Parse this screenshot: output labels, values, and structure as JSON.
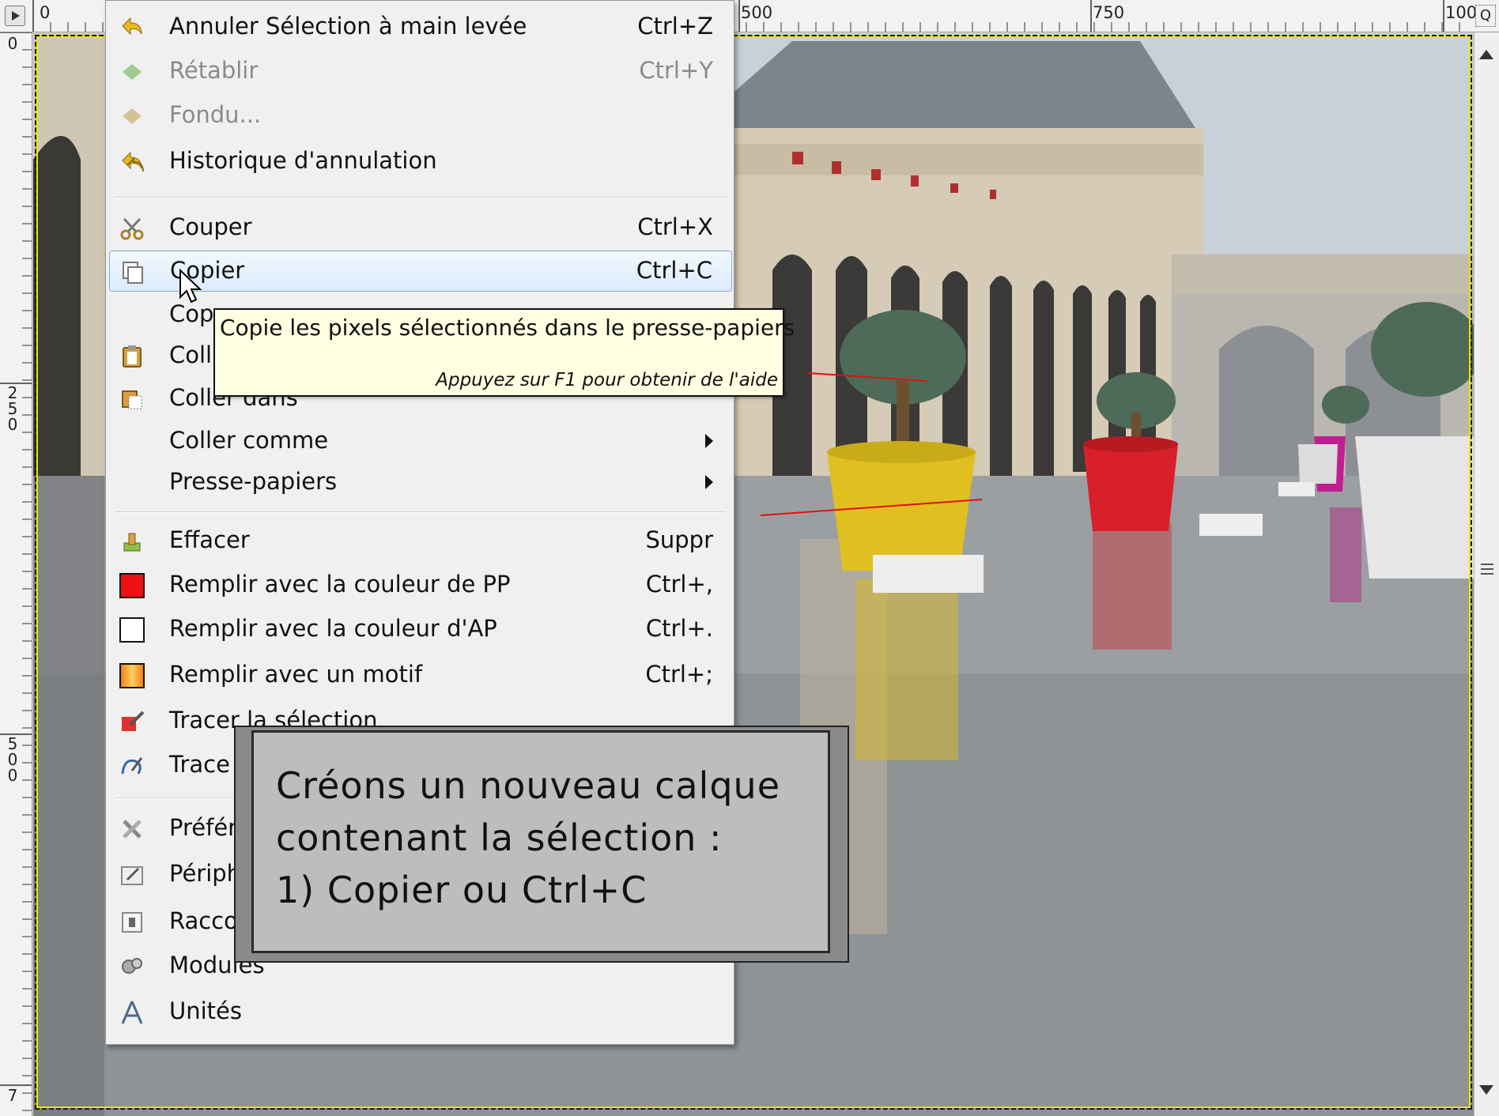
{
  "rulers": {
    "top_ticks": [
      "0",
      "500",
      "750",
      "100"
    ],
    "left_ticks": [
      "0",
      "2\n5\n0",
      "5\n0\n0",
      "7"
    ]
  },
  "zoom_button_label": "Q",
  "edit_menu": {
    "items": [
      {
        "label": "Annuler Sélection à main levée",
        "shortcut": "Ctrl+Z",
        "icon": "undo-icon",
        "enabled": true
      },
      {
        "label": "Rétablir",
        "shortcut": "Ctrl+Y",
        "icon": "redo-icon",
        "enabled": false
      },
      {
        "label": "Fondu...",
        "shortcut": "",
        "icon": "fade-icon",
        "enabled": false
      },
      {
        "label": "Historique d'annulation",
        "shortcut": "",
        "icon": "undo-history-icon",
        "enabled": true
      },
      {
        "label": "Couper",
        "shortcut": "Ctrl+X",
        "icon": "scissors-icon",
        "enabled": true
      },
      {
        "label": "Copier",
        "shortcut": "Ctrl+C",
        "icon": "copy-icon",
        "enabled": true,
        "highlighted": true
      },
      {
        "label": "Cop",
        "shortcut": "",
        "icon": "",
        "enabled": true
      },
      {
        "label": "Coll",
        "shortcut": "",
        "icon": "paste-icon",
        "enabled": true
      },
      {
        "label": "Coller dans",
        "shortcut": "",
        "icon": "paste-into-icon",
        "enabled": true
      },
      {
        "label": "Coller comme",
        "shortcut": "",
        "icon": "",
        "enabled": true,
        "submenu": true
      },
      {
        "label": "Presse-papiers",
        "shortcut": "",
        "icon": "",
        "enabled": true,
        "submenu": true
      },
      {
        "label": "Effacer",
        "shortcut": "Suppr",
        "icon": "clear-icon",
        "enabled": true
      },
      {
        "label": "Remplir avec la couleur de PP",
        "shortcut": "Ctrl+,",
        "icon": "fill-fg-icon",
        "enabled": true
      },
      {
        "label": "Remplir avec la couleur d'AP",
        "shortcut": "Ctrl+.",
        "icon": "fill-bg-icon",
        "enabled": true
      },
      {
        "label": "Remplir avec un motif",
        "shortcut": "Ctrl+;",
        "icon": "fill-pattern-icon",
        "enabled": true
      },
      {
        "label": "Tracer la sélection",
        "shortcut": "",
        "icon": "stroke-selection-icon",
        "enabled": true
      },
      {
        "label": "Trace",
        "shortcut": "",
        "icon": "stroke-path-icon",
        "enabled": true
      },
      {
        "label": "Préfér",
        "shortcut": "",
        "icon": "preferences-icon",
        "enabled": true
      },
      {
        "label": "Périph",
        "shortcut": "",
        "icon": "devices-icon",
        "enabled": true
      },
      {
        "label": "Racco",
        "shortcut": "",
        "icon": "shortcuts-icon",
        "enabled": true
      },
      {
        "label": "Modules",
        "shortcut": "",
        "icon": "modules-icon",
        "enabled": true
      },
      {
        "label": "Unités",
        "shortcut": "",
        "icon": "units-icon",
        "enabled": true
      }
    ]
  },
  "tooltip": {
    "text": "Copie les pixels sélectionnés dans le presse-papiers",
    "hint": "Appuyez sur F1 pour obtenir de l'aide"
  },
  "callout": {
    "lines": [
      "Créons un nouveau calque",
      "contenant la sélection :",
      "1) Copier ou Ctrl+C"
    ]
  },
  "colors": {
    "fill_fg": "#ee1111",
    "fill_bg": "#ffffff",
    "tooltip_bg": "#ffffe1",
    "menu_bg": "#f0f0f0",
    "highlight_border": "#84acdd",
    "pot_yellow": "#e0c020",
    "pot_red": "#d8202a",
    "pot_magenta": "#c0208f"
  }
}
